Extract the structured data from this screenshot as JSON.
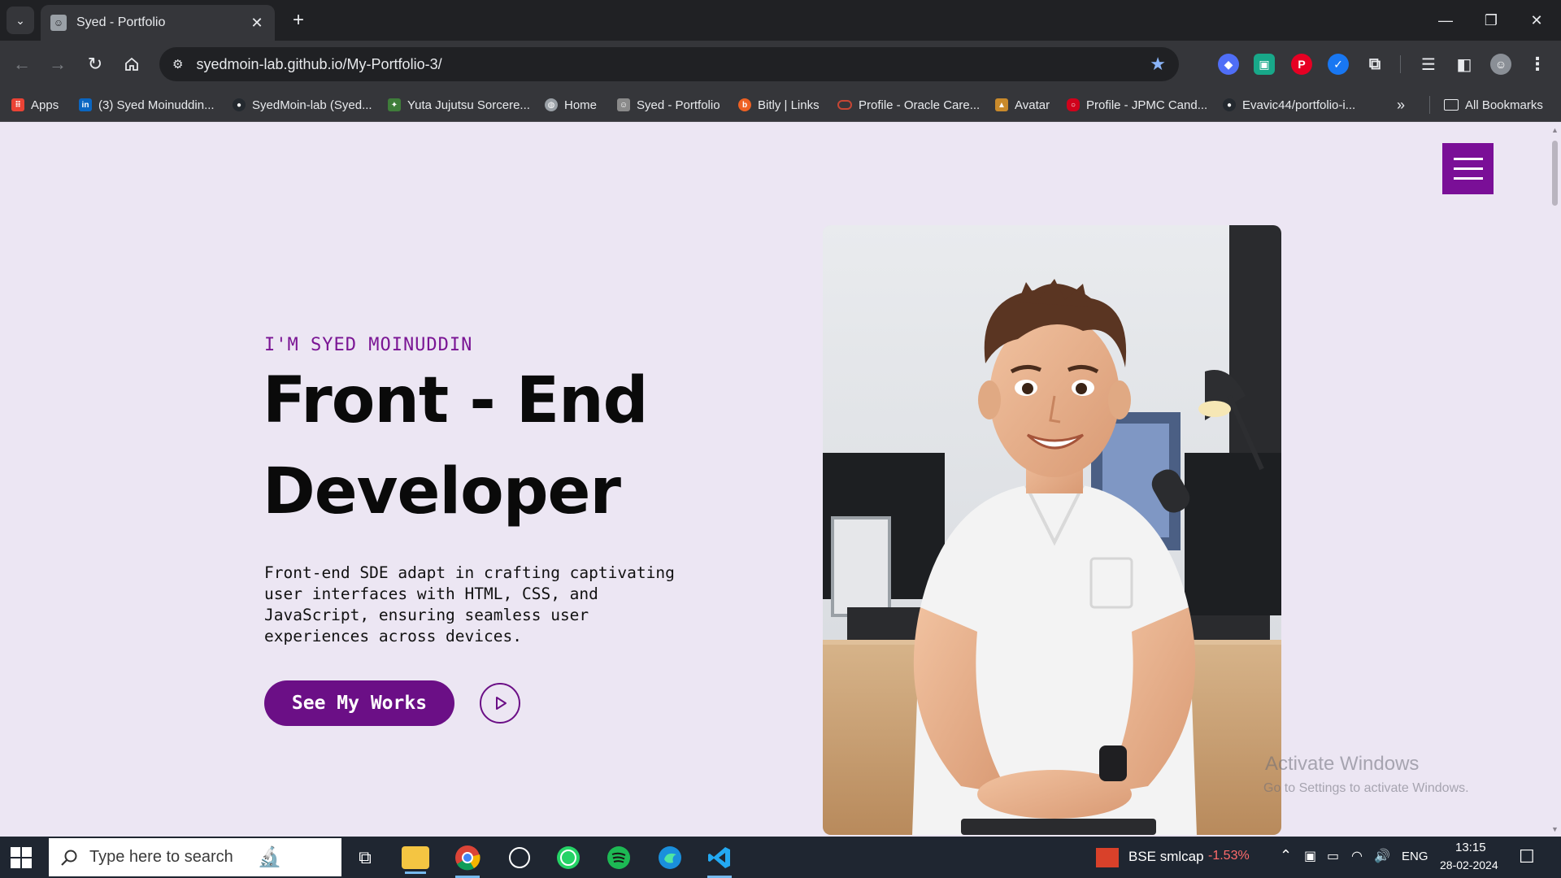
{
  "browser": {
    "tab_title": "Syed - Portfolio",
    "url": "syedmoin-lab.github.io/My-Portfolio-3/",
    "bookmarks": [
      {
        "label": "Apps",
        "icon": "apps-grid-icon",
        "color": "#ea4335"
      },
      {
        "label": "(3) Syed Moinuddin...",
        "icon": "linkedin-icon",
        "color": "#0a66c2"
      },
      {
        "label": "SyedMoin-lab (Syed...",
        "icon": "github-icon",
        "color": "#24292f"
      },
      {
        "label": "Yuta Jujutsu Sorcere...",
        "icon": "anime-icon",
        "color": "#3f7d3a"
      },
      {
        "label": "Home",
        "icon": "globe-icon",
        "color": "#9aa0a6"
      },
      {
        "label": "Syed - Portfolio",
        "icon": "portfolio-icon",
        "color": "#8a8a8a"
      },
      {
        "label": "Bitly | Links",
        "icon": "bitly-icon",
        "color": "#ee6123"
      },
      {
        "label": "Profile - Oracle Care...",
        "icon": "oracle-icon",
        "color": "#c74634"
      },
      {
        "label": "Avatar",
        "icon": "avatar-icon",
        "color": "#c98a2b"
      },
      {
        "label": "Profile - JPMC Cand...",
        "icon": "jpmc-icon",
        "color": "#d0021b"
      },
      {
        "label": "Evavic44/portfolio-i...",
        "icon": "github-icon",
        "color": "#24292f"
      }
    ],
    "all_bookmarks_label": "All Bookmarks"
  },
  "page": {
    "intro": "I'M SYED MOINUDDIN",
    "headline_line1": "Front - End",
    "headline_line2": "Developer",
    "description": "Front-end SDE adapt in crafting captivating user interfaces with HTML, CSS, and JavaScript, ensuring seamless user experiences across devices.",
    "cta_label": "See My Works",
    "accent_color": "#6b0f86",
    "background_color": "#ece6f3"
  },
  "watermark": {
    "line1": "Activate Windows",
    "line2": "Go to Settings to activate Windows."
  },
  "taskbar": {
    "search_placeholder": "Type here to search",
    "stock_name": "BSE smlcap",
    "stock_change": "-1.53%",
    "language": "ENG",
    "time": "13:15",
    "date": "28-02-2024"
  }
}
